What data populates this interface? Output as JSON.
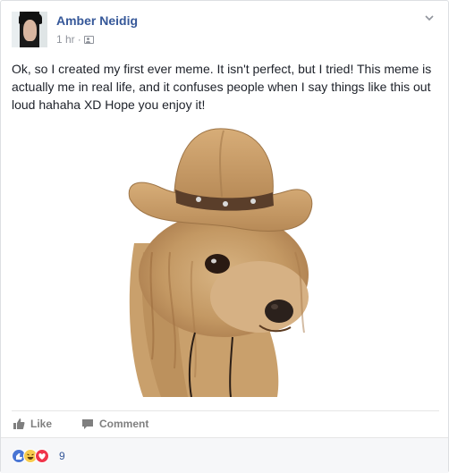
{
  "post": {
    "author": "Amber Neidig",
    "timestamp": "1 hr",
    "separator": "·",
    "audience_icon": "friends-icon",
    "text": "Ok, so I created my first ever meme. It isn't perfect, but I tried! This meme is actually me in real life, and it confuses people when I say things like this out loud hahaha XD Hope you enjoy it!",
    "photo_subject": "dog-in-cowboy-hat-photo"
  },
  "actions": {
    "like_label": "Like",
    "comment_label": "Comment"
  },
  "reactions": {
    "count": "9",
    "types": [
      "like",
      "haha",
      "love"
    ]
  },
  "colors": {
    "author_link": "#365899",
    "meta_gray": "#90949c",
    "action_gray": "#7f7f7f",
    "like_blue": "#4a76d4",
    "haha_yellow": "#f7cb4d",
    "love_red": "#f0354b"
  }
}
